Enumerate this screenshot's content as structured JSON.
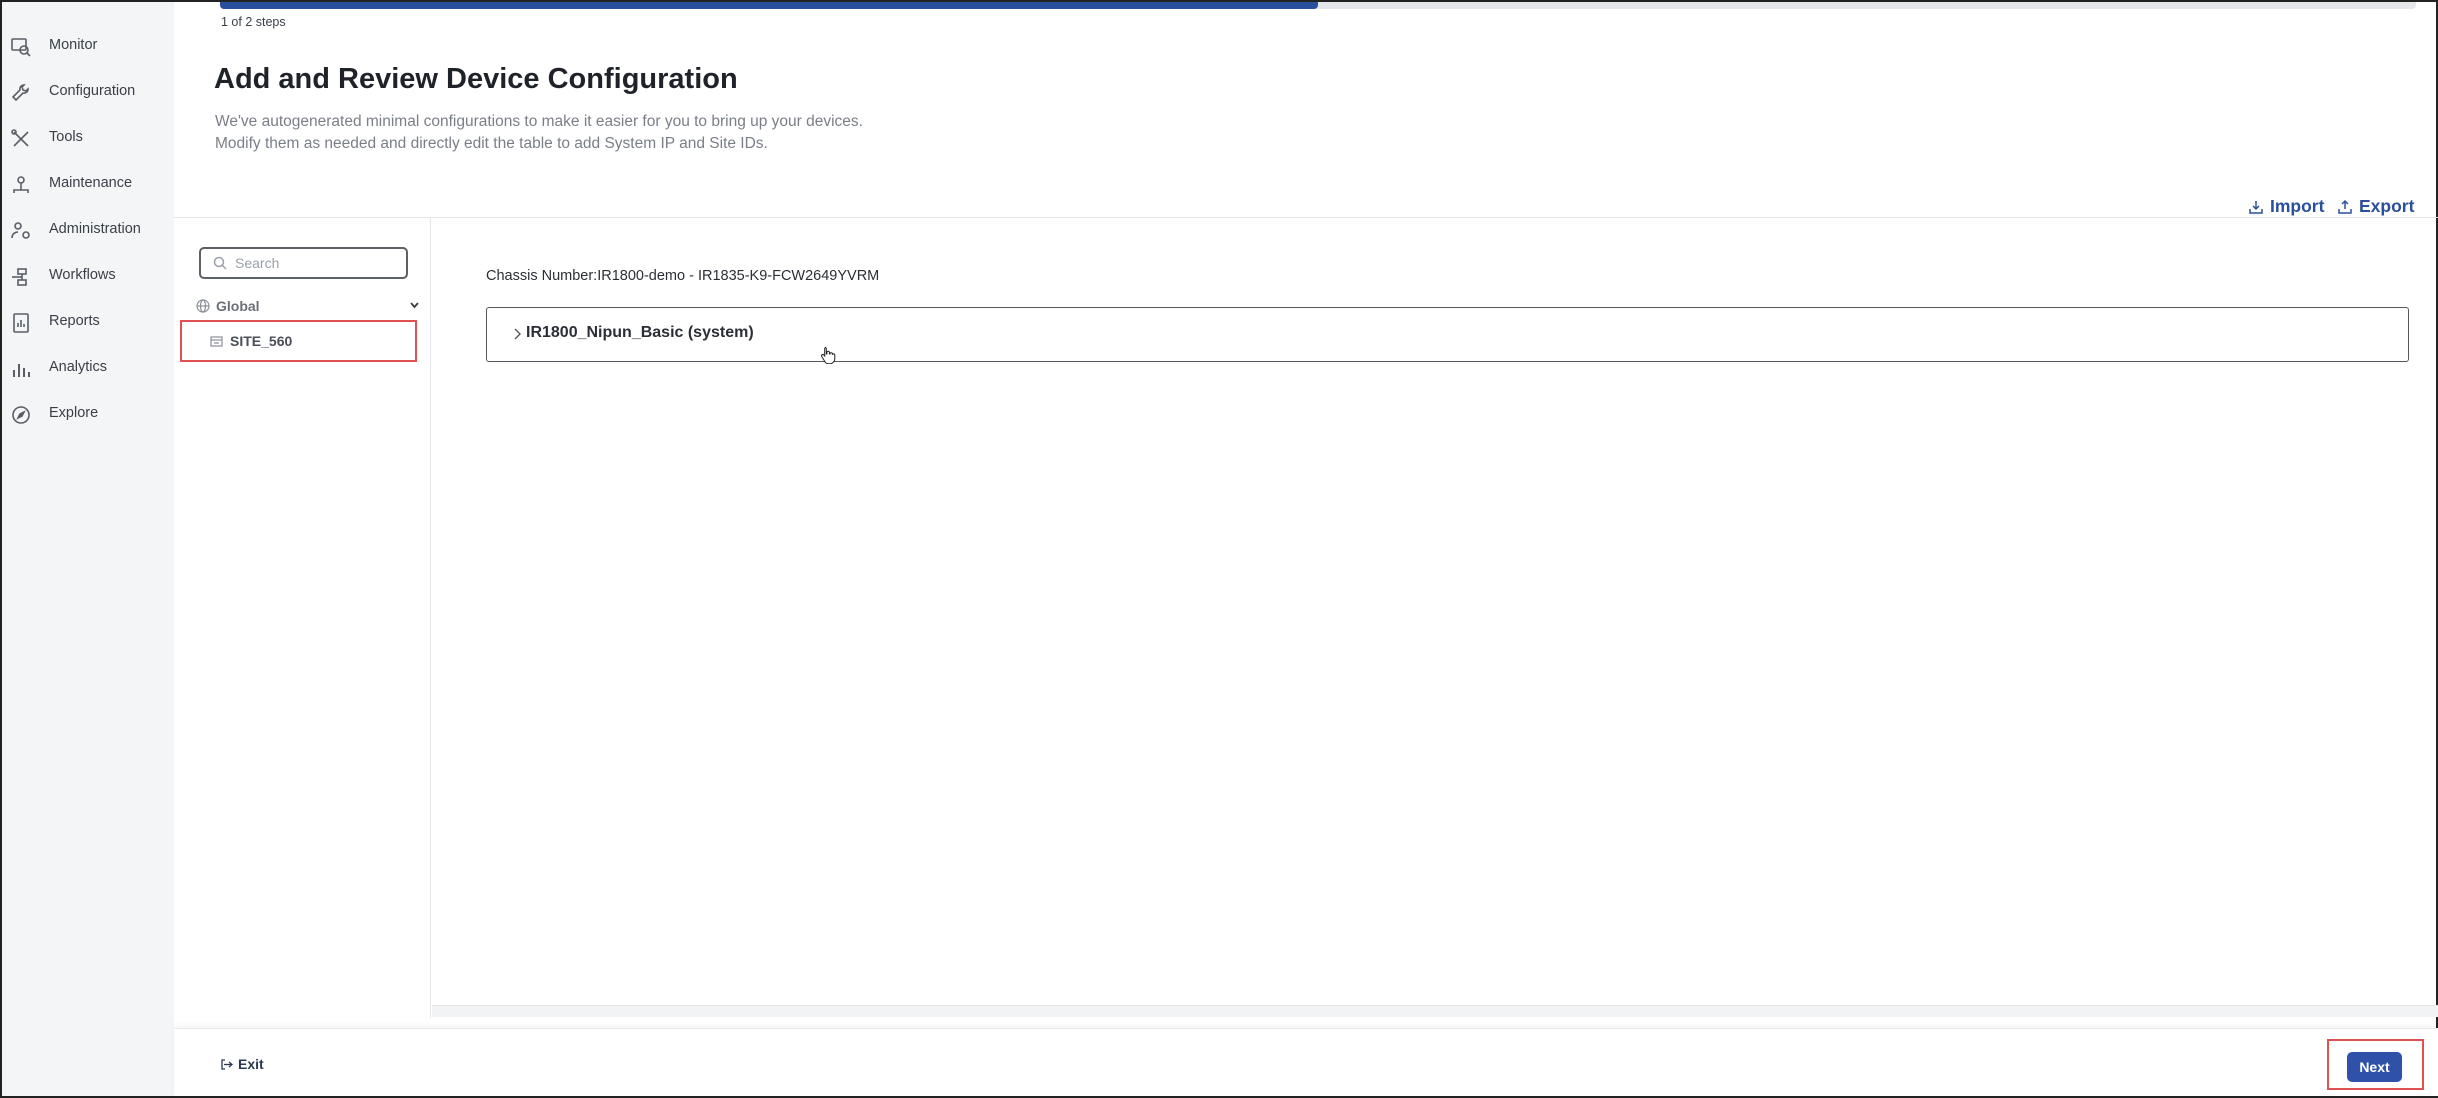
{
  "sidebar": {
    "items": [
      {
        "label": "Monitor",
        "icon": "monitor-icon"
      },
      {
        "label": "Configuration",
        "icon": "wrench-icon"
      },
      {
        "label": "Tools",
        "icon": "tools-icon"
      },
      {
        "label": "Maintenance",
        "icon": "maintenance-icon"
      },
      {
        "label": "Administration",
        "icon": "admin-icon"
      },
      {
        "label": "Workflows",
        "icon": "workflow-icon"
      },
      {
        "label": "Reports",
        "icon": "report-icon"
      },
      {
        "label": "Analytics",
        "icon": "analytics-icon"
      },
      {
        "label": "Explore",
        "icon": "compass-icon"
      }
    ]
  },
  "progress": {
    "fraction": 0.5,
    "steps_text": "1 of 2 steps"
  },
  "page": {
    "title": "Add and Review Device Configuration",
    "description_line1": "We've autogenerated minimal configurations to make it easier for you to bring up your devices.",
    "description_line2": "Modify them as needed and directly edit the table to add System IP and Site IDs."
  },
  "actions": {
    "import_label": "Import",
    "export_label": "Export"
  },
  "tree": {
    "search_placeholder": "Search",
    "global_label": "Global",
    "site_label": "SITE_560"
  },
  "main": {
    "chassis_text": "Chassis Number:IR1800-demo - IR1835-K9-FCW2649YVRM",
    "accordion_label": "IR1800_Nipun_Basic (system)"
  },
  "footer": {
    "exit_label": "Exit",
    "next_label": "Next"
  },
  "colors": {
    "accent": "#2f52a8",
    "progress": "#2a4f9c",
    "highlight_border": "#e05252"
  }
}
